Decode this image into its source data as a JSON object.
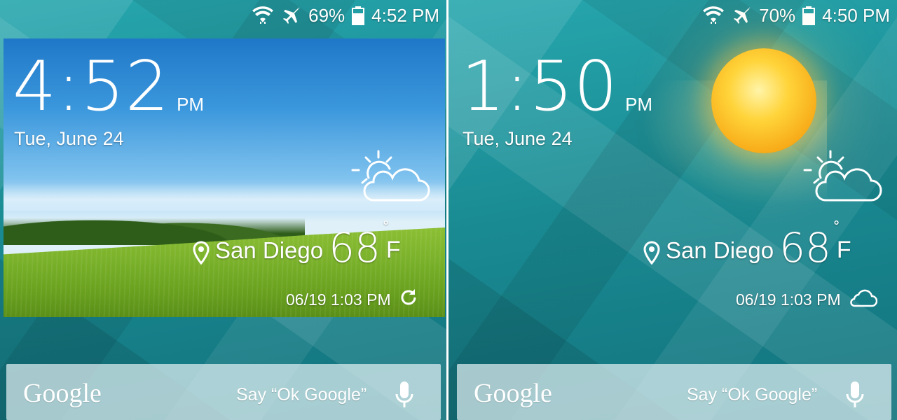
{
  "left": {
    "status": {
      "battery": "69%",
      "time": "4:52 PM"
    },
    "clock": {
      "time": "4:52",
      "ampm": "PM",
      "date": "Tue, June 24"
    },
    "weather": {
      "city": "San Diego",
      "temp": "68",
      "unit": "F",
      "degree": "˚",
      "updated": "06/19 1:03 PM",
      "icon": "partly-cloudy-icon",
      "status_icon": "refresh-icon"
    },
    "search": {
      "logo": "Google",
      "hint": "Say “Ok Google”"
    }
  },
  "right": {
    "status": {
      "battery": "70%",
      "time": "4:50 PM"
    },
    "clock": {
      "time": "1:50",
      "ampm": "PM",
      "date": "Tue, June 24"
    },
    "weather": {
      "city": "San Diego",
      "temp": "68",
      "unit": "F",
      "degree": "˚",
      "updated": "06/19 1:03 PM",
      "icon": "partly-cloudy-icon",
      "status_icon": "cloud-icon"
    },
    "search": {
      "logo": "Google",
      "hint": "Say “Ok Google”"
    }
  },
  "colors": {
    "wallpaper_teal": "#1a8b93",
    "text": "#ffffff",
    "sun": "#ffd43a"
  }
}
